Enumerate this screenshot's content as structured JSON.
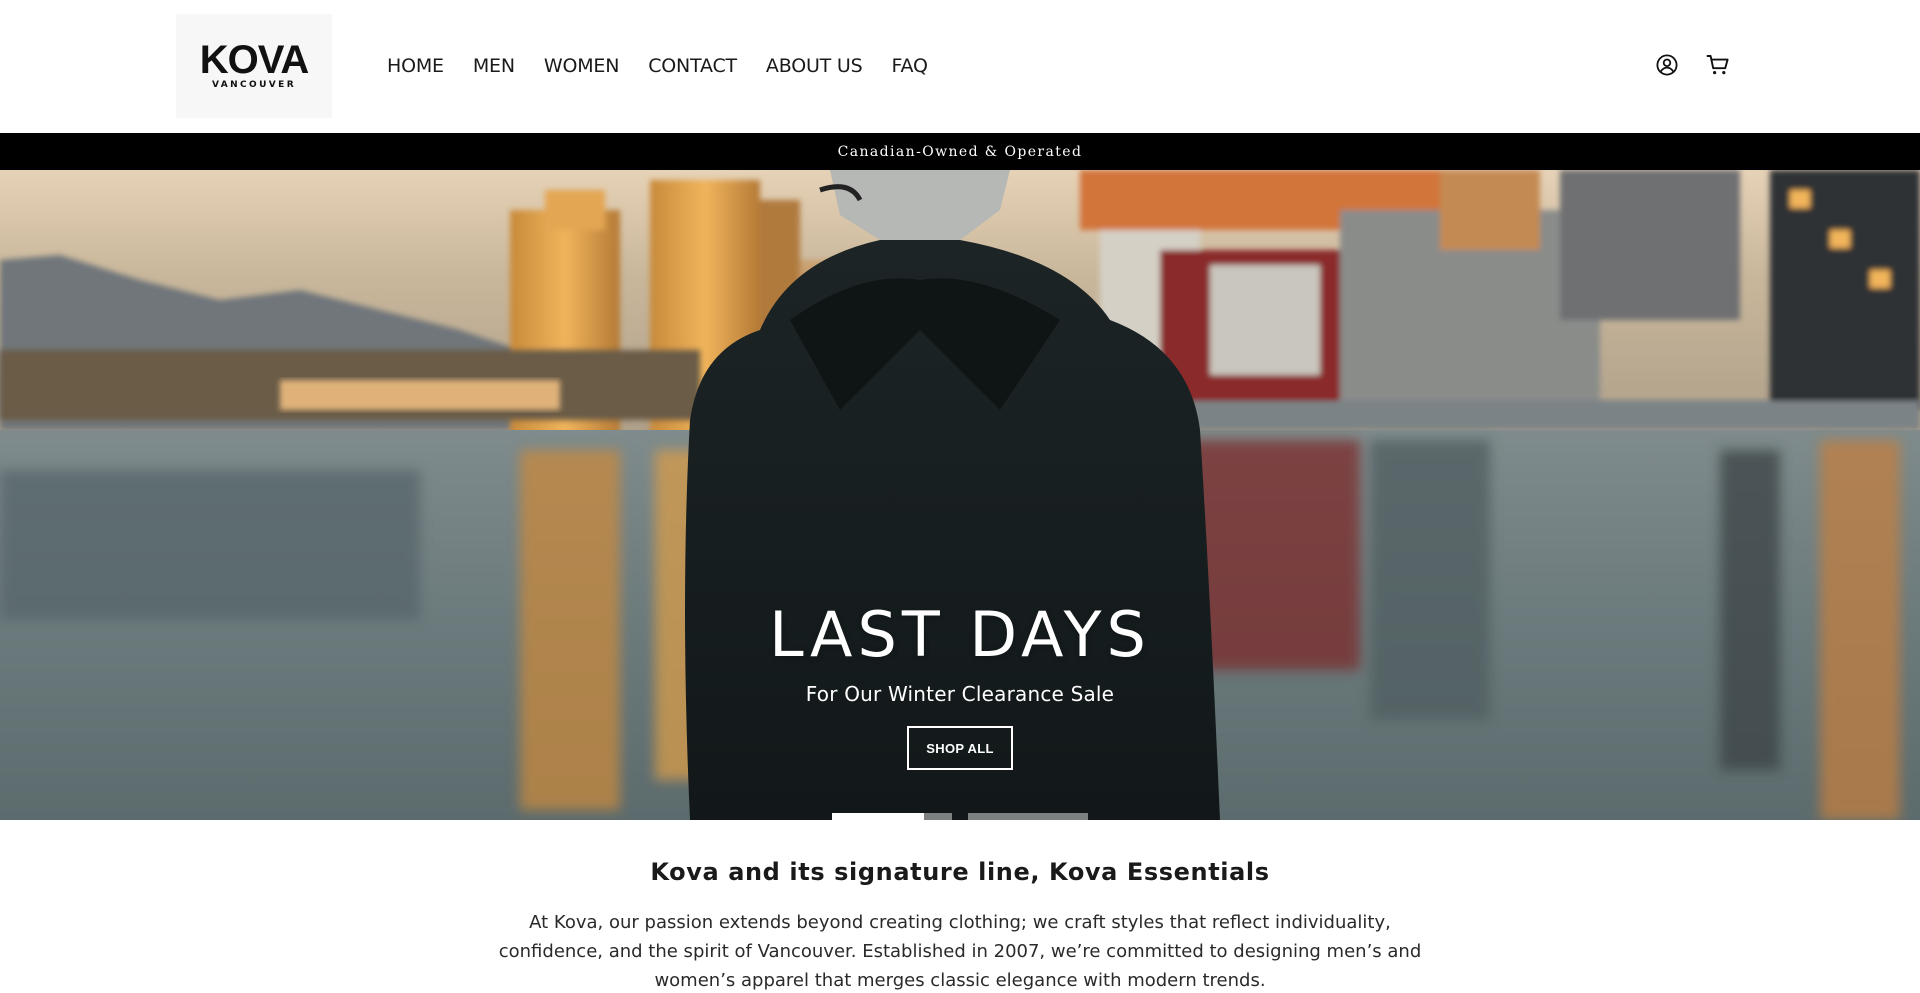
{
  "brand": {
    "name": "KOVA",
    "tagline": "VANCOUVER"
  },
  "nav": {
    "items": [
      "HOME",
      "MEN",
      "WOMEN",
      "CONTACT",
      "ABOUT US",
      "FAQ"
    ]
  },
  "header_icons": {
    "account": "account-circle-icon",
    "cart": "shopping-cart-icon"
  },
  "announcement": {
    "text": "Canadian-Owned & Operated"
  },
  "hero": {
    "title": "LAST DAYS",
    "subtitle": "For Our Winter Clearance Sale",
    "cta_label": "SHOP ALL",
    "slide_count": 2,
    "active_slide": 1
  },
  "about": {
    "title": "Kova and its signature line, Kova Essentials",
    "body": "At Kova, our passion extends beyond creating clothing; we craft styles that reflect individuality, confidence, and the spirit of Vancouver. Established in 2007, we’re committed to designing men’s and women’s apparel that merges classic elegance with modern trends."
  },
  "colors": {
    "announcement_bg": "#000000",
    "text_primary": "#1a1a1a",
    "page_bg": "#ffffff"
  }
}
